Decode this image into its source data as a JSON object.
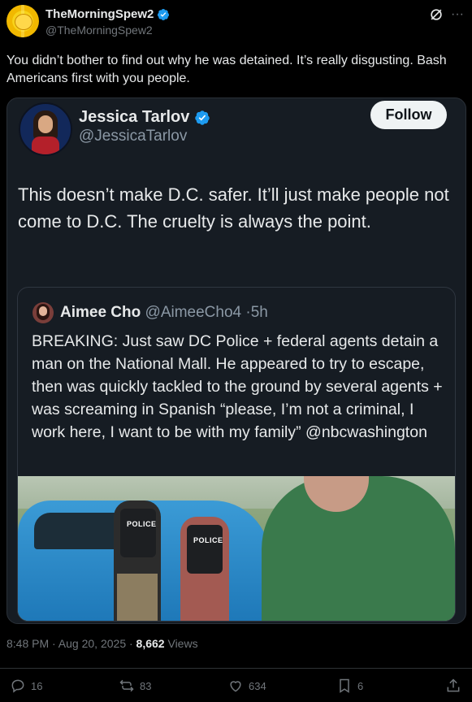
{
  "tweet": {
    "author_name": "TheMorningSpew2",
    "author_handle": "@TheMorningSpew2",
    "text": "You didn’t bother to find out why he was detained. It’s really disgusting. Bash Americans first with you people."
  },
  "embedded": {
    "author_name": "Jessica Tarlov",
    "author_handle": "@JessicaTarlov",
    "follow_label": "Follow",
    "text": "This doesn’t make D.C. safer. It’ll just make people not come to D.C. The cruelty is always the point.",
    "quote": {
      "author_name": "Aimee Cho",
      "author_handle": "@AimeeCho4",
      "time": "5h",
      "separator": "·",
      "text": "BREAKING: Just saw DC Police + federal agents detain a man on the National Mall. He appeared to try to escape, then was quickly tackled to the ground by several agents + was screaming in Spanish “please, I’m not a criminal, I work here, I want to be with my family” @nbcwashington",
      "photo_labels": {
        "vest_police": "POLICE",
        "vest_badge": "POLICE"
      }
    }
  },
  "meta": {
    "time_date": "8:48 PM · Aug 20, 2025 · ",
    "views_count": "8,662",
    "views_label": " Views"
  },
  "actions": {
    "replies": "16",
    "reposts": "83",
    "likes": "634",
    "bookmarks": "6"
  },
  "colors": {
    "verified": "#1d9bf0",
    "muted": "#71767b",
    "background": "#000000"
  }
}
